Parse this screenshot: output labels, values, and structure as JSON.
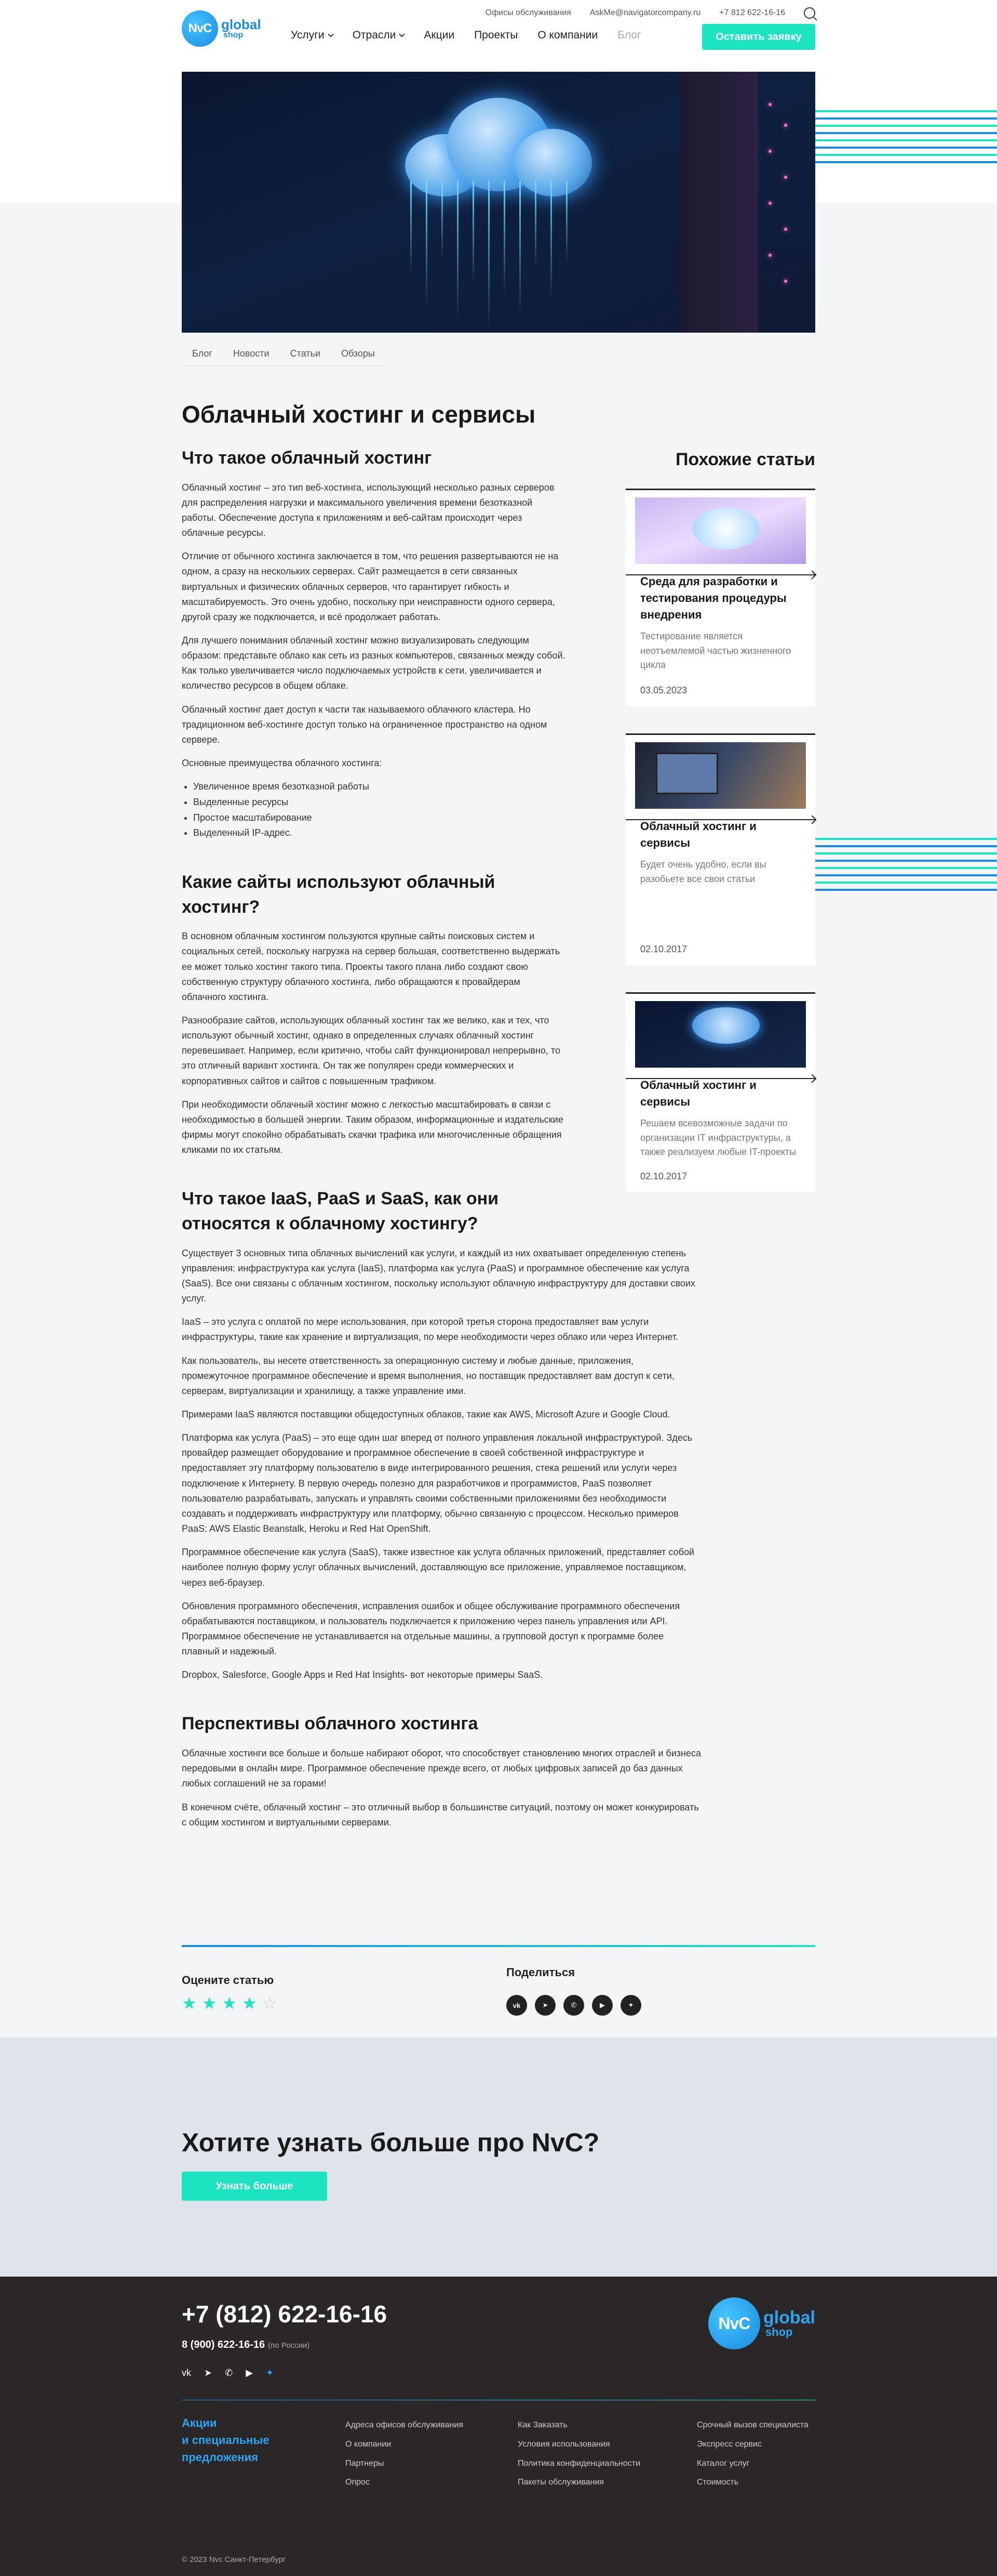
{
  "header": {
    "logo_mark": "NvC",
    "logo_word": "global",
    "logo_sub": "shop",
    "top_links": [
      "Офисы обслуживания",
      "AskMe@navigatorcompany.ru",
      "+7 812 622-16-16"
    ],
    "nav": [
      {
        "label": "Услуги",
        "dropdown": true
      },
      {
        "label": "Отрасли",
        "dropdown": true
      },
      {
        "label": "Акции",
        "dropdown": false
      },
      {
        "label": "Проекты",
        "dropdown": false
      },
      {
        "label": "О компании",
        "dropdown": false
      },
      {
        "label": "Блог",
        "dropdown": false,
        "muted": true
      }
    ],
    "cta": "Оставить заявку"
  },
  "tabs": [
    "Блог",
    "Новости",
    "Статьи",
    "Обзоры"
  ],
  "article": {
    "title": "Облачный хостинг и сервисы",
    "s1_title": "Что такое облачный хостинг",
    "s1_p1": "Облачный хостинг – это тип веб-хостинга, использующий несколько разных серверов для распределения нагрузки и максимального увеличения времени безотказной работы. Обеспечение доступа к приложениям и веб-сайтам происходит через облачные ресурсы.",
    "s1_p2": "Отличие от обычного хостинга заключается в том, что решения развертываются не на одном, а сразу на нескольких серверах. Сайт размещается в сети связанных виртуальных и физических облачных серверов, что гарантирует гибкость и масштабируемость. Это очень удобно, поскольку при неисправности одного сервера, другой сразу же подключается, и всё продолжает работать.",
    "s1_p3": "Для лучшего понимания облачный хостинг можно визуализировать следующим образом: представьте облако как сеть из разных компьютеров, связанных между собой. Как только увеличивается число подключаемых устройств к сети, увеличивается и количество ресурсов в общем облаке.",
    "s1_p4": "Облачный хостинг дает доступ к части так называемого облачного кластера. Но традиционном веб-хостинге доступ только на ограниченное пространство на одном сервере.",
    "s1_p5": "Основные преимущества облачного хостинга:",
    "s1_list": [
      "Увеличенное время безотказной работы",
      "Выделенные ресурсы",
      "Простое масштабирование",
      "Выделенный IP-адрес."
    ],
    "s2_title": "Какие сайты используют облачный хостинг?",
    "s2_p1": "В основном облачным хостингом пользуются крупные сайты поисковых систем и социальных сетей, поскольку нагрузка на сервер большая, соответственно выдержать ее может только хостинг такого типа. Проекты такого плана либо создают свою собственную структуру облачного хостинга, либо обращаются к провайдерам облачного хостинга.",
    "s2_p2": "Разнообразие сайтов, использующих облачный хостинг так же велико, как и тех, что используют обычный хостинг, однако в определенных случаях облачный хостинг перевешивает. Например, если критично, чтобы сайт функционировал непрерывно, то это отличный вариант хостинга. Он так же популярен среди коммерческих и корпоративных сайтов и сайтов с повышенным трафиком.",
    "s2_p3": "При необходимости облачный хостинг можно с легкостью масштабировать в связи с необходимостью в большей энергии. Таким образом, информационные и издательские фирмы могут спокойно обрабатывать скачки трафика или многочисленные обращения кликами по их статьям.",
    "s3_title": "Что такое IaaS, PaaS и SaaS, как они относятся к облачному хостингу?",
    "s3_p1": "Существует 3 основных типа облачных вычислений как услуги, и каждый из них охватывает определенную степень управления: инфраструктура как услуга (IaaS), платформа как услуга (PaaS) и программное обеспечение как услуга (SaaS). Все они связаны с облачным хостингом, поскольку используют облачную инфраструктуру для доставки своих услуг.",
    "s3_p2": "IaaS – это услуга с оплатой по мере использования, при которой третья сторона предоставляет вам услуги инфраструктуры, такие как хранение и виртуализация, по мере необходимости через облако или через Интернет.",
    "s3_p3": "Как пользователь, вы несете ответственность за операционную систему и любые данные, приложения, промежуточное программное обеспечение и время выполнения, но поставщик предоставляет вам доступ к сети, серверам, виртуализации и хранилищу, а также управление ими.",
    "s3_p4": "Примерами IaaS являются поставщики общедоступных облаков, такие как AWS, Microsoft Azure и Google Cloud.",
    "s3_p5": "Платформа как услуга (PaaS) – это еще один шаг вперед от полного управления локальной инфраструктурой. Здесь провайдер размещает оборудование и программное обеспечение в своей собственной инфраструктуре и предоставляет эту платформу пользователю в виде интегрированного решения, стека решений или услуги через подключение к Интернету. В первую очередь полезно для разработчиков и программистов, PaaS позволяет пользователю разрабатывать, запускать и управлять своими собственными приложениями без необходимости создавать и поддерживать инфраструктуру или платформу, обычно связанную с процессом. Несколько примеров PaaS: AWS Elastic Beanstalk, Heroku и Red Hat OpenShift.",
    "s3_p6": "Программное обеспечение как услуга (SaaS), также известное как услуга облачных приложений, представляет собой наиболее полную форму услуг облачных вычислений, доставляющую все приложение, управляемое поставщиком, через веб-браузер.",
    "s3_p7": "Обновления программного обеспечения, исправления ошибок и общее обслуживание программного обеспечения обрабатываются поставщиком, и пользователь подключается к приложению через панель управления или API. Программное обеспечение не устанавливается на отдельные машины, а групповой доступ к программе более плавный и надежный.",
    "s3_p8": "Dropbox, Salesforce, Google Apps и Red Hat Insights- вот некоторые примеры SaaS.",
    "s4_title": "Перспективы облачного хостинга",
    "s4_p1": "Облачные хостинги все больше и больше набирают оборот, что способствует становлению многих отраслей и бизнеса передовыми в онлайн мире. Программное обеспечение прежде всего, от любых цифровых записей до баз данных любых соглашений не за горами!",
    "s4_p2": "В конечном счёте, облачный хостинг – это отличный выбор в большинстве ситуаций, поэтому он может конкурировать с общим хостингом и виртуальными серверами."
  },
  "similar": {
    "title": "Похожие статьи",
    "cards": [
      {
        "title": "Среда для разработки и тестирования процедуры внедрения",
        "text": "Тестирование является неотъемлемой частью жизненного цикла",
        "date": "03.05.2023"
      },
      {
        "title": "Облачный хостинг и сервисы",
        "text": "Будет очень удобно, если вы разобьете все свои статьи",
        "date": "02.10.2017"
      },
      {
        "title": "Облачный хостинг и сервисы",
        "text": "Решаем всевозможные задачи по организации IT инфраструктуры, а также реализуем любые IT-проекты",
        "date": "02.10.2017"
      }
    ]
  },
  "rating": {
    "label": "Оцените статью",
    "value": 4,
    "max": 5
  },
  "share": {
    "label": "Поделиться",
    "networks": [
      "vk-icon",
      "telegram-icon",
      "whatsapp-icon",
      "youtube-icon",
      "twitter-icon"
    ]
  },
  "cta": {
    "title": "Хотите узнать больше про NvC?",
    "button": "Узнать больше"
  },
  "footer": {
    "phone": "+7 (812) 622-16-16",
    "phone2": "8 (900) 622-16-16",
    "phone2_note": "(по России)",
    "promo": [
      "Акции",
      "и специальные",
      "предложения"
    ],
    "col1": [
      "Адреса офисов обслуживания",
      "О компании",
      "Партнеры",
      "Опрос"
    ],
    "col2": [
      "Как Заказать",
      "Условия использования",
      "Политика конфиденциальности",
      "Пакеты обслуживания"
    ],
    "col3": [
      "Срочный вызов специалиста",
      "Экспресс сервис",
      "Каталог услуг",
      "Стоимость"
    ],
    "copyright": "© 2023 Nvc  Санкт-Петербург"
  },
  "colors": {
    "accent": "#1de4c0",
    "brand": "#1a8be0",
    "footer_bg": "#2b2728"
  }
}
